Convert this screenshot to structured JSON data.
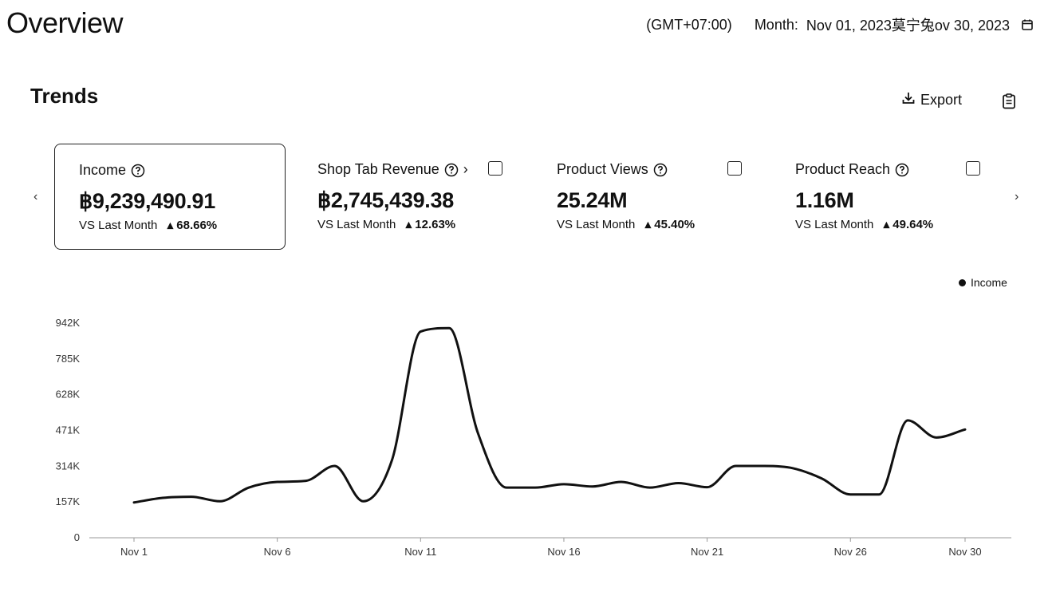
{
  "header": {
    "title": "Overview",
    "timezone": "(GMT+07:00)",
    "month_label": "Month:",
    "date_range": "Nov 01, 2023莫宁兔ov 30, 2023"
  },
  "trends": {
    "title": "Trends",
    "export_label": "Export",
    "cards": [
      {
        "label": "Income",
        "value": "฿9,239,490.91",
        "compare_label": "VS Last Month",
        "change": "68.66%",
        "selected": true
      },
      {
        "label": "Shop Tab Revenue",
        "value": "฿2,745,439.38",
        "compare_label": "VS Last Month",
        "change": "12.63%",
        "selected": false
      },
      {
        "label": "Product Views",
        "value": "25.24M",
        "compare_label": "VS Last Month",
        "change": "45.40%",
        "selected": false
      },
      {
        "label": "Product Reach",
        "value": "1.16M",
        "compare_label": "VS Last Month",
        "change": "49.64%",
        "selected": false
      }
    ]
  },
  "icons": {
    "calendar": "calendar-icon",
    "export": "download-icon",
    "clipboard": "clipboard-icon",
    "help": "help-circle-icon",
    "prev": "chevron-left-icon",
    "next": "chevron-right-icon"
  },
  "chart_data": {
    "type": "line",
    "legend": "Income",
    "legend_position": "top-right",
    "x_tick_labels": [
      "Nov 1",
      "Nov 6",
      "Nov 11",
      "Nov 16",
      "Nov 21",
      "Nov 26",
      "Nov 30"
    ],
    "x_tick_days": [
      1,
      6,
      11,
      16,
      21,
      26,
      30
    ],
    "y_tick_labels": [
      "0",
      "157K",
      "314K",
      "471K",
      "628K",
      "785K",
      "942K"
    ],
    "ylim": [
      0,
      942
    ],
    "series": [
      {
        "name": "Income",
        "color": "#111111",
        "x": [
          1,
          2,
          3,
          4,
          5,
          6,
          7,
          8,
          9,
          10,
          11,
          12,
          13,
          14,
          15,
          16,
          17,
          18,
          19,
          20,
          21,
          22,
          23,
          24,
          25,
          26,
          27,
          28,
          29,
          30
        ],
        "y": [
          155,
          175,
          180,
          160,
          220,
          245,
          250,
          315,
          160,
          340,
          905,
          920,
          460,
          220,
          220,
          235,
          225,
          245,
          220,
          240,
          222,
          315,
          315,
          305,
          260,
          190,
          190,
          515,
          440,
          475
        ]
      }
    ],
    "grid": false
  }
}
